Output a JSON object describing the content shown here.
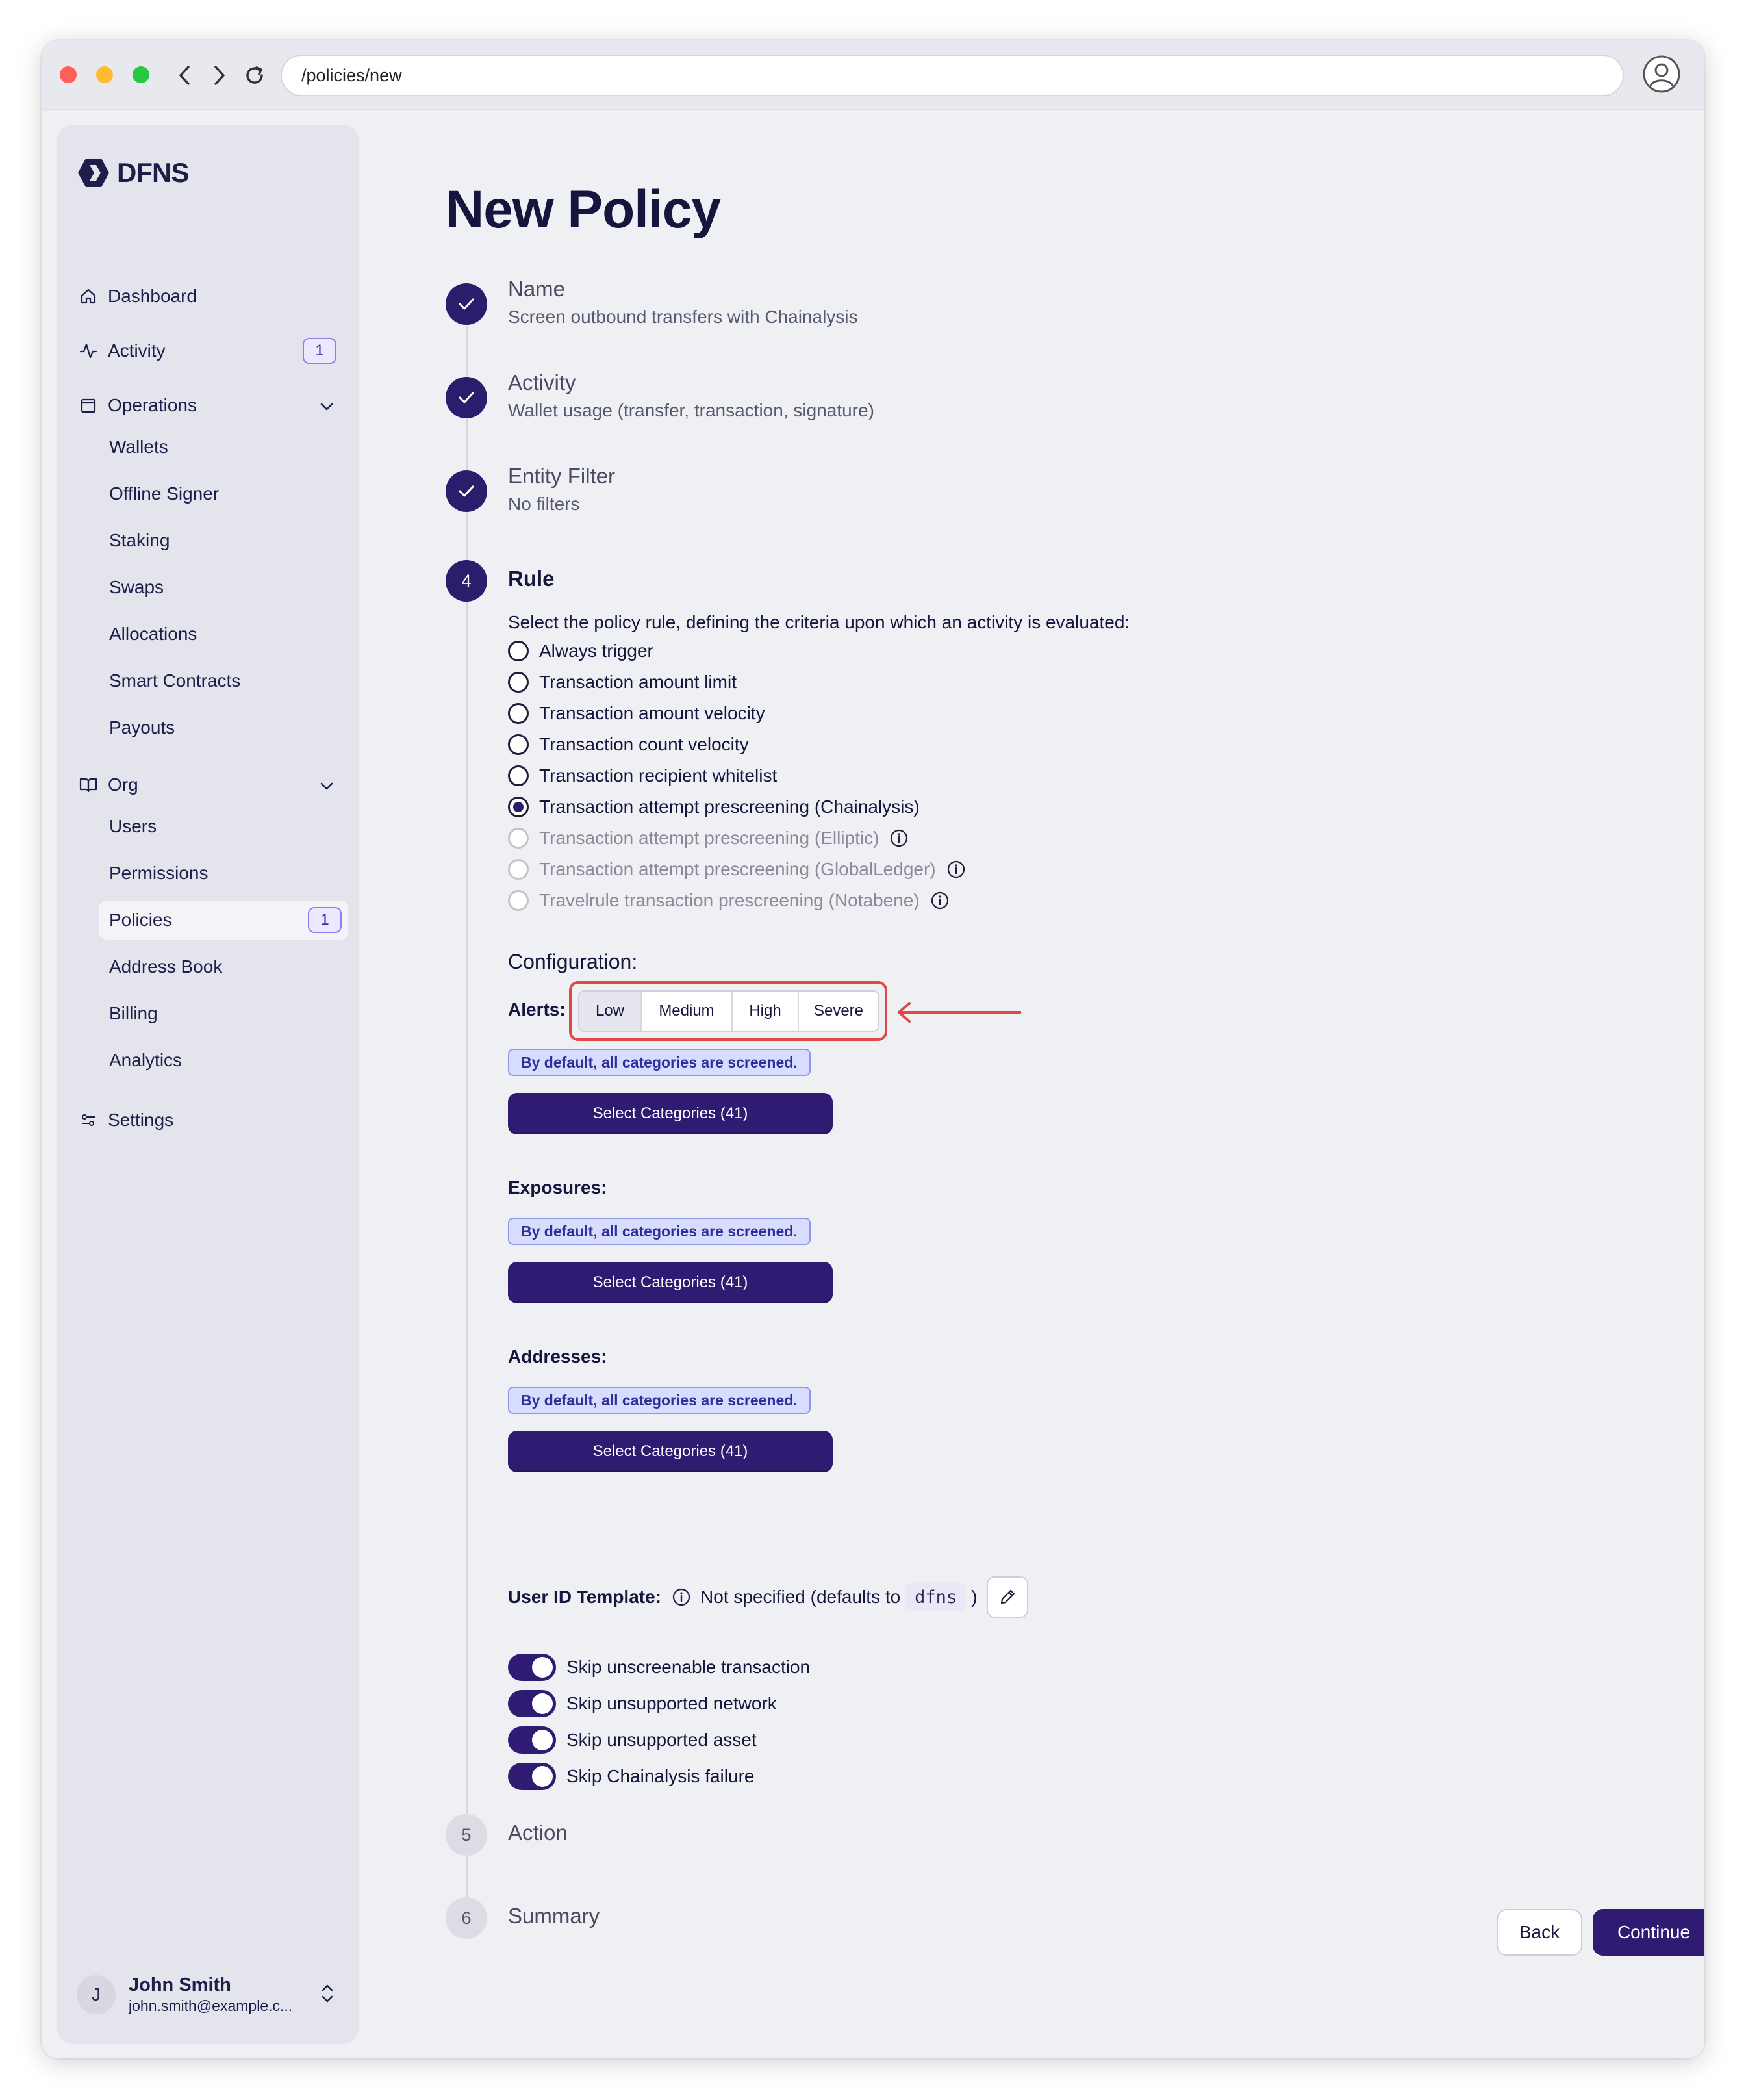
{
  "browser": {
    "url": "/policies/new"
  },
  "sidebar": {
    "brand": "DFNS",
    "items": [
      {
        "label": "Dashboard"
      },
      {
        "label": "Activity",
        "badge": "1"
      },
      {
        "label": "Operations"
      },
      {
        "label": "Wallets"
      },
      {
        "label": "Offline Signer"
      },
      {
        "label": "Staking"
      },
      {
        "label": "Swaps"
      },
      {
        "label": "Allocations"
      },
      {
        "label": "Smart Contracts"
      },
      {
        "label": "Payouts"
      },
      {
        "label": "Org"
      },
      {
        "label": "Users"
      },
      {
        "label": "Permissions"
      },
      {
        "label": "Policies",
        "badge": "1"
      },
      {
        "label": "Address Book"
      },
      {
        "label": "Billing"
      },
      {
        "label": "Analytics"
      },
      {
        "label": "Settings"
      }
    ],
    "user": {
      "initial": "J",
      "name": "John Smith",
      "email": "john.smith@example.c..."
    }
  },
  "main": {
    "title": "New Policy",
    "steps": [
      {
        "title": "Name",
        "subtitle": "Screen outbound transfers with Chainalysis"
      },
      {
        "title": "Activity",
        "subtitle": "Wallet usage (transfer, transaction, signature)"
      },
      {
        "title": "Entity Filter",
        "subtitle": "No filters"
      },
      {
        "number": "4",
        "title": "Rule"
      },
      {
        "number": "5",
        "title": "Action"
      },
      {
        "number": "6",
        "title": "Summary"
      }
    ],
    "rule": {
      "description": "Select the policy rule, defining the criteria upon which an activity is evaluated:",
      "options": [
        {
          "label": "Always trigger"
        },
        {
          "label": "Transaction amount limit"
        },
        {
          "label": "Transaction amount velocity"
        },
        {
          "label": "Transaction count velocity"
        },
        {
          "label": "Transaction recipient whitelist"
        },
        {
          "label": "Transaction attempt prescreening (Chainalysis)"
        },
        {
          "label": "Transaction attempt prescreening (Elliptic)"
        },
        {
          "label": "Transaction attempt prescreening (GlobalLedger)"
        },
        {
          "label": "Travelrule transaction prescreening (Notabene)"
        }
      ],
      "selected": "Transaction attempt prescreening (Chainalysis)"
    },
    "config": {
      "heading": "Configuration:",
      "alerts_label": "Alerts:",
      "alert_levels": [
        "Low",
        "Medium",
        "High",
        "Severe"
      ],
      "alert_selected": "Low",
      "default_note": "By default, all categories are screened.",
      "select_button": "Select Categories (41)",
      "exposures_label": "Exposures:",
      "addresses_label": "Addresses:",
      "user_id_label": "User ID Template:",
      "user_id_value_prefix": "Not specified (defaults to",
      "user_id_default": "dfns",
      "user_id_value_suffix": ")",
      "toggles": [
        {
          "label": "Skip unscreenable transaction",
          "on": true
        },
        {
          "label": "Skip unsupported network",
          "on": true
        },
        {
          "label": "Skip unsupported asset",
          "on": true
        },
        {
          "label": "Skip Chainalysis failure",
          "on": true
        }
      ]
    },
    "actions": {
      "back": "Back",
      "continue": "Continue"
    }
  },
  "colors": {
    "primary": "#2f1c72",
    "highlight": "#e04848",
    "info_bg": "#d8dcff"
  }
}
